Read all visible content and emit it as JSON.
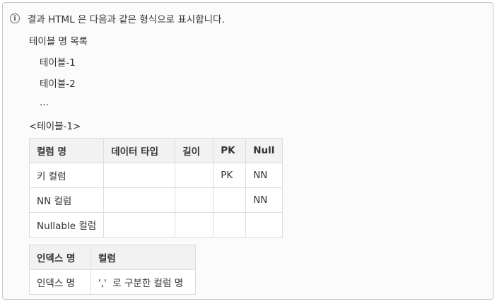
{
  "intro": {
    "icon": "info-icon",
    "text": "결과 HTML 은 다음과 같은 형식으로 표시합니다."
  },
  "list_heading": "테이블 명 목록",
  "list_items": [
    "테이블-1",
    "테이블-2",
    "..."
  ],
  "table_caption": "<테이블-1>",
  "columns_table": {
    "headers": [
      "컬럼 명",
      "데이터 타입",
      "길이",
      "PK",
      "Null"
    ],
    "rows": [
      [
        "키 컬럼",
        "",
        "",
        "PK",
        "NN"
      ],
      [
        "NN 컬럼",
        "",
        "",
        "",
        "NN"
      ],
      [
        "Nullable 컬럼",
        "",
        "",
        "",
        ""
      ]
    ]
  },
  "index_table": {
    "headers": [
      "인덱스 명",
      "컬럼"
    ],
    "rows": [
      [
        "인덱스 명",
        "','  로 구분한 컬럼 명"
      ]
    ]
  }
}
